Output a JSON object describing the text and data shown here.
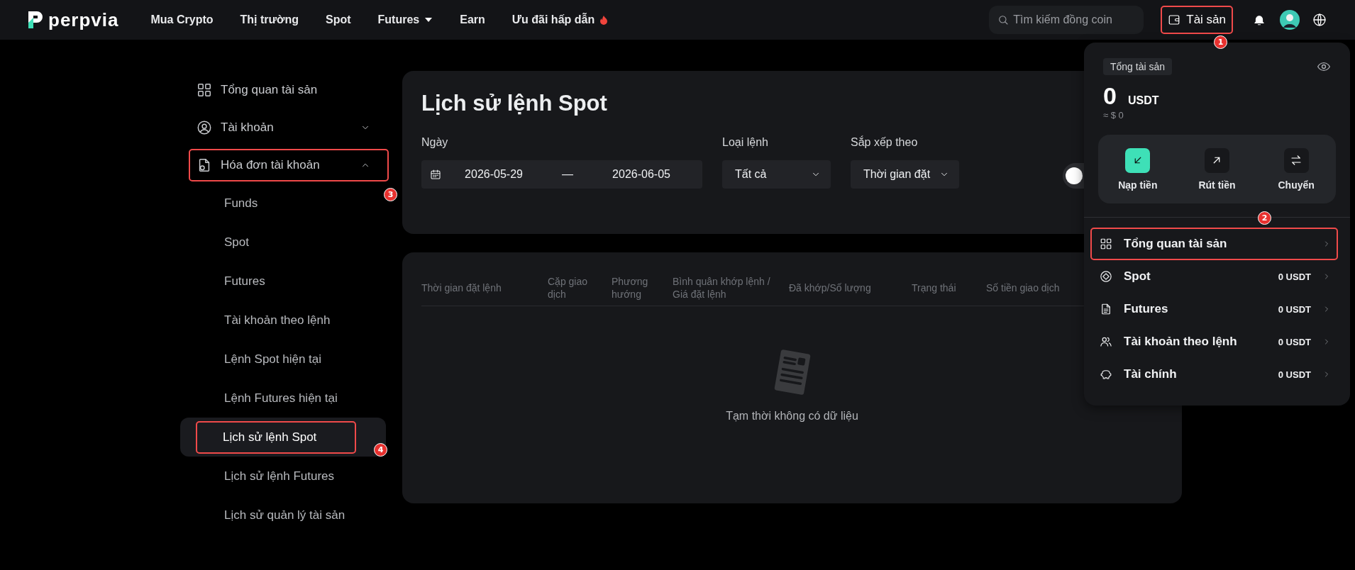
{
  "header": {
    "logo": "perpvia",
    "nav": [
      {
        "label": "Mua Crypto",
        "kind": "link"
      },
      {
        "label": "Thị trường",
        "kind": "link"
      },
      {
        "label": "Spot",
        "kind": "link"
      },
      {
        "label": "Futures",
        "kind": "menu"
      },
      {
        "label": "Earn",
        "kind": "link"
      },
      {
        "label": "Ưu đãi hấp dẫn",
        "kind": "promo"
      }
    ],
    "search": {
      "placeholder": "Tìm kiếm đồng coin"
    },
    "assets_button": {
      "label": "Tài sản",
      "annotation": "1"
    }
  },
  "sidebar": {
    "items": [
      {
        "label": "Tổng quan tài sản",
        "kind": "overview"
      },
      {
        "label": "Tài khoản",
        "kind": "account",
        "expanded": false
      },
      {
        "label": "Hóa đơn tài khoản",
        "kind": "bills",
        "expanded": true,
        "annotation": "3",
        "children": [
          {
            "label": "Funds",
            "selected": false
          },
          {
            "label": "Spot",
            "selected": false
          },
          {
            "label": "Futures",
            "selected": false
          },
          {
            "label": "Tài khoản theo lệnh",
            "selected": false
          },
          {
            "label": "Lệnh Spot hiện tại",
            "selected": false
          },
          {
            "label": "Lệnh Futures hiện tại",
            "selected": false
          },
          {
            "label": "Lịch sử lệnh Spot",
            "selected": true,
            "annotation": "4"
          },
          {
            "label": "Lịch sử lệnh Futures",
            "selected": false
          },
          {
            "label": "Lịch sử quản lý tài sản",
            "selected": false
          }
        ]
      }
    ]
  },
  "filters": {
    "title": "Lịch sử lệnh Spot",
    "fields": [
      {
        "label": "Ngày",
        "kind": "date-range",
        "start": "2026-05-29",
        "separator": "—",
        "end": "2026-06-05"
      },
      {
        "label": "Loại lệnh",
        "kind": "select",
        "value": "Tất cả"
      },
      {
        "label": "Sắp xếp theo",
        "kind": "select",
        "value": "Thời gian đặt"
      }
    ],
    "toggle": {
      "on": false
    }
  },
  "table": {
    "columns": [
      "Thời gian đặt lệnh",
      "Cặp giao dịch",
      "Phương hướng",
      "Bình quân khớp lệnh / Giá đặt lệnh",
      "Đã khớp/Số lượng",
      "Trạng thái",
      "Số tiền giao dịch"
    ],
    "empty_text": "Tạm thời không có dữ liệu"
  },
  "assets_panel": {
    "total_label": "Tổng tài sản",
    "amount": "0",
    "currency": "USDT",
    "approx": "≈ $ 0",
    "actions": [
      {
        "label": "Nạp tiền",
        "kind": "deposit",
        "primary": true
      },
      {
        "label": "Rút tiền",
        "kind": "withdraw",
        "primary": false
      },
      {
        "label": "Chuyển",
        "kind": "transfer",
        "primary": false
      }
    ],
    "rows": [
      {
        "label": "Tổng quan tài sản",
        "kind": "overview",
        "annotation": "2"
      },
      {
        "label": "Spot",
        "kind": "spot",
        "value": "0 USDT"
      },
      {
        "label": "Futures",
        "kind": "futures",
        "value": "0 USDT"
      },
      {
        "label": "Tài khoản theo lệnh",
        "kind": "copy",
        "value": "0 USDT"
      },
      {
        "label": "Tài chính",
        "kind": "finance",
        "value": "0 USDT"
      }
    ]
  }
}
